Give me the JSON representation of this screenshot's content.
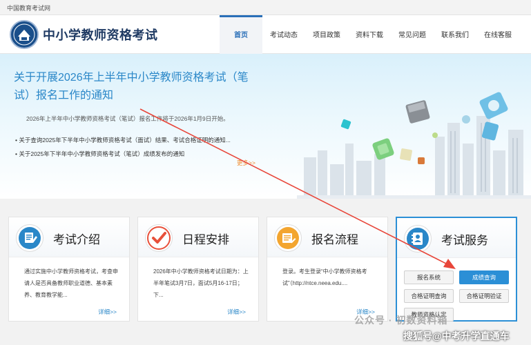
{
  "top_strip": {
    "site_name": "中国教育考试网"
  },
  "header": {
    "title": "中小学教师资格考试",
    "nav": [
      {
        "label": "首页",
        "active": true
      },
      {
        "label": "考试动态"
      },
      {
        "label": "项目政策"
      },
      {
        "label": "资料下载"
      },
      {
        "label": "常见问题"
      },
      {
        "label": "联系我们"
      },
      {
        "label": "在线客服"
      }
    ]
  },
  "banner": {
    "headline": "关于开展2026年上半年中小学教师资格考试（笔试）报名工作的通知",
    "summary": "2026年上半年中小学教师资格考试（笔试）报名工作将于2026年1月9日开始。",
    "news": [
      "关于查询2025年下半年中小学教师资格考试（面试）结果、考试合格证明的通知...",
      "关于2025年下半年中小学教师资格考试（笔试）成绩发布的通知"
    ],
    "more": "更多>>"
  },
  "cards": [
    {
      "title": "考试介绍",
      "text": "通过实施中小学教师资格考试，考查申请人是否具备教师职业道德、基本素养、教育教学能...",
      "detail": "详细>>"
    },
    {
      "title": "日程安排",
      "text": "2026年中小学教师资格考试日期为：上半年笔试3月7日，面试5月16-17日；下...",
      "detail": "详细>>"
    },
    {
      "title": "报名流程",
      "text": "登录。考生登录“中小学教师资格考试”（http://ntce.neea.edu....",
      "detail": "详细>>"
    }
  ],
  "service": {
    "title": "考试服务",
    "buttons": [
      "报名系统",
      "成绩查询",
      "合格证明查询",
      "合格证明验证",
      "教师资格认定"
    ]
  },
  "watermark": {
    "line1": "公众号 · 初数资料箱",
    "line2": "搜狐号@中考升学直通车"
  },
  "colors": {
    "accent": "#2b8fd6",
    "title_blue": "#2a87c8",
    "arrow_red": "#e8463a",
    "more_orange": "#f08a2a"
  }
}
